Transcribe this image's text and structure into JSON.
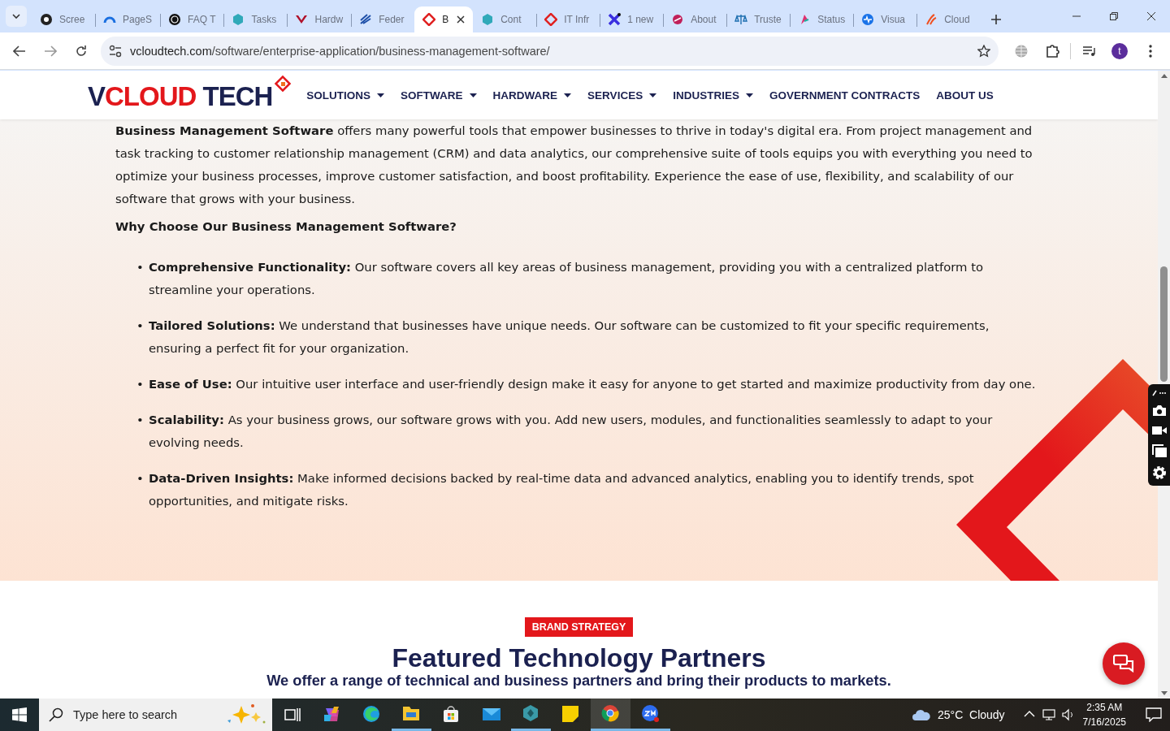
{
  "browser": {
    "tabs": [
      {
        "label": "Scree",
        "selected": false
      },
      {
        "label": "PageS",
        "selected": false
      },
      {
        "label": "FAQ T",
        "selected": false
      },
      {
        "label": "Tasks",
        "selected": false
      },
      {
        "label": "Hardw",
        "selected": false
      },
      {
        "label": "Feder",
        "selected": false
      },
      {
        "label": "B",
        "selected": true
      },
      {
        "label": "Cont",
        "selected": false
      },
      {
        "label": "IT Infr",
        "selected": false
      },
      {
        "label": "1 new",
        "selected": false
      },
      {
        "label": "About",
        "selected": false
      },
      {
        "label": "Truste",
        "selected": false
      },
      {
        "label": "Status",
        "selected": false
      },
      {
        "label": "Visua",
        "selected": false
      },
      {
        "label": "Cloud",
        "selected": false
      }
    ],
    "address": {
      "host": "vcloudtech.com",
      "path": "/software/enterprise-application/business-management-software/"
    },
    "profile": "t"
  },
  "site": {
    "logo": [
      {
        "text": "V",
        "kind": "dark"
      },
      {
        "text": "CLOUD",
        "kind": "accent"
      },
      {
        "text": "TECH",
        "kind": "dark"
      }
    ],
    "nav": [
      {
        "label": "SOLUTIONS",
        "dropdown": true
      },
      {
        "label": "SOFTWARE",
        "dropdown": true
      },
      {
        "label": "HARDWARE",
        "dropdown": true
      },
      {
        "label": "SERVICES",
        "dropdown": true
      },
      {
        "label": "INDUSTRIES",
        "dropdown": true
      },
      {
        "label": "GOVERNMENT CONTRACTS",
        "dropdown": false
      },
      {
        "label": "ABOUT US",
        "dropdown": false
      }
    ],
    "intro": "**Business Management Software** offers many powerful tools that empower businesses to thrive in today's digital era. From project management and task tracking to customer relationship management (CRM) and data analytics, our comprehensive suite of tools equips you with everything you need to optimize your business processes, improve customer satisfaction, and boost profitability. Experience the ease of use, flexibility, and scalability of our software that grows with your business.",
    "why_heading": "Why Choose Our Business Management Software?",
    "benefits": [
      {
        "marker": "•",
        "text": "**Comprehensive Functionality:** Our software covers all key areas of business management, providing you with a centralized platform to streamline your operations."
      },
      {
        "marker": "•",
        "text": "**Tailored Solutions:** We understand that businesses have unique needs. Our software can be customized to fit your specific requirements, ensuring a perfect fit for your organization."
      },
      {
        "marker": "•",
        "text": "**Ease of Use:** Our intuitive user interface and user-friendly design make it easy for anyone to get started and maximize productivity from day one."
      },
      {
        "marker": "•",
        "text": "**Scalability:** As your business grows, our software grows with you. Add new users, modules, and functionalities seamlessly to adapt to your evolving needs."
      },
      {
        "marker": "•",
        "text": "**Data-Driven Insights:** Make informed decisions backed by real-time data and advanced analytics, enabling you to identify trends, spot opportunities, and mitigate risks."
      }
    ],
    "badge": "BRAND STRATEGY",
    "partners_title": "Featured Technology Partners",
    "partners_subtitle": "We offer a range of technical and business partners and bring their products to markets."
  },
  "taskbar": {
    "search_placeholder": "Type here to search",
    "apps": [
      {
        "kind": "copilot",
        "running": false,
        "selected": false
      },
      {
        "kind": "edge",
        "running": false,
        "selected": false
      },
      {
        "kind": "folder",
        "running": true,
        "selected": false
      },
      {
        "kind": "store",
        "running": false,
        "selected": false
      },
      {
        "kind": "mail",
        "running": false,
        "selected": false
      },
      {
        "kind": "hexagon",
        "running": true,
        "selected": false
      },
      {
        "kind": "notes",
        "running": false,
        "selected": false
      },
      {
        "kind": "chrome",
        "running": true,
        "selected": true
      },
      {
        "kind": "zoom",
        "running": true,
        "selected": false
      }
    ],
    "weather": "25°C  Cloudy",
    "time": "2:35 AM",
    "date": "7/16/2025"
  }
}
